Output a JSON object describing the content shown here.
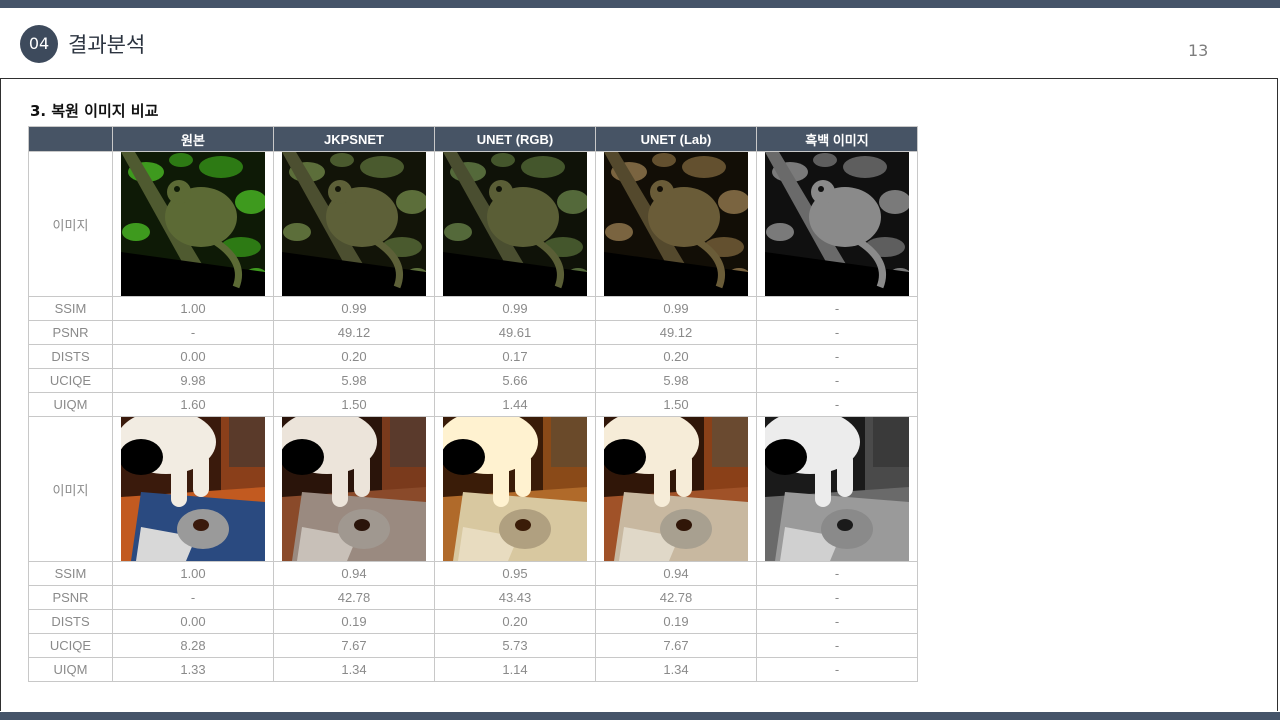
{
  "header": {
    "section_number": "04",
    "section_title": "결과분석",
    "page_number": "13"
  },
  "subtitle": "3. 복원 이미지 비교",
  "table": {
    "columns": [
      "",
      "원본",
      "JKPSNET",
      "UNET (RGB)",
      "UNET (Lab)",
      "흑백 이미지"
    ],
    "image_row_label": "이미지",
    "groups": [
      {
        "image_subject": "chameleon on branch",
        "metrics": [
          {
            "name": "SSIM",
            "values": [
              "1.00",
              "0.99",
              "0.99",
              "0.99",
              "-"
            ]
          },
          {
            "name": "PSNR",
            "values": [
              "-",
              "49.12",
              "49.61",
              "49.12",
              "-"
            ]
          },
          {
            "name": "DISTS",
            "values": [
              "0.00",
              "0.20",
              "0.17",
              "0.20",
              "-"
            ]
          },
          {
            "name": "UCIQE",
            "values": [
              "9.98",
              "5.98",
              "5.66",
              "5.98",
              "-"
            ]
          },
          {
            "name": "UIQM",
            "values": [
              "1.60",
              "1.50",
              "1.44",
              "1.50",
              "-"
            ]
          }
        ]
      },
      {
        "image_subject": "cat with computer mouse",
        "metrics": [
          {
            "name": "SSIM",
            "values": [
              "1.00",
              "0.94",
              "0.95",
              "0.94",
              "-"
            ]
          },
          {
            "name": "PSNR",
            "values": [
              "-",
              "42.78",
              "43.43",
              "42.78",
              "-"
            ]
          },
          {
            "name": "DISTS",
            "values": [
              "0.00",
              "0.19",
              "0.20",
              "0.19",
              "-"
            ]
          },
          {
            "name": "UCIQE",
            "values": [
              "8.28",
              "7.67",
              "5.73",
              "7.67",
              "-"
            ]
          },
          {
            "name": "UIQM",
            "values": [
              "1.33",
              "1.34",
              "1.14",
              "1.34",
              "-"
            ]
          }
        ]
      }
    ]
  },
  "colors": {
    "accent": "#455469",
    "header_fill": "#475465"
  }
}
